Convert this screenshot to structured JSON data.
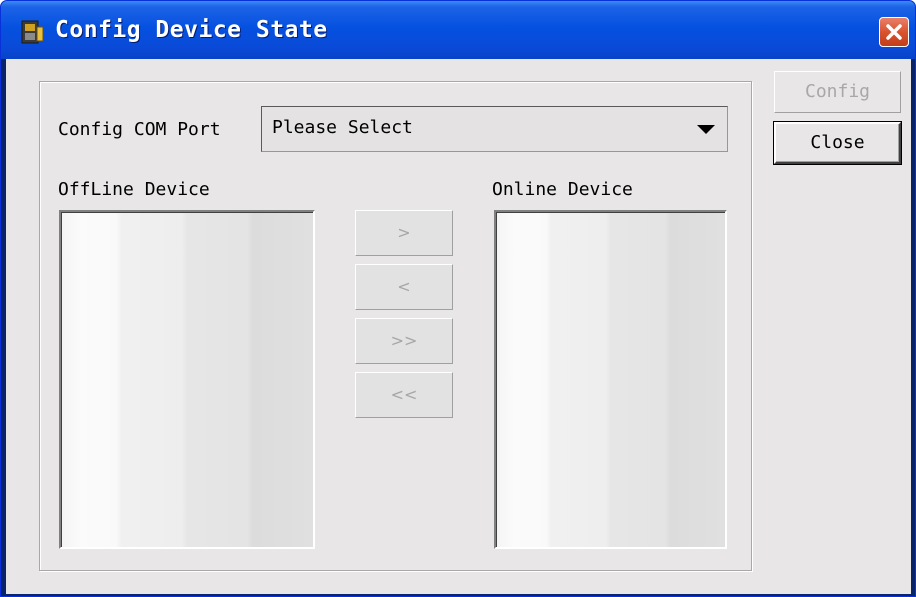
{
  "window": {
    "title": "Config Device State",
    "icon": "application-icon",
    "close_icon": "close-icon"
  },
  "com_port": {
    "label": "Config COM Port",
    "selected": "Please Select"
  },
  "offline": {
    "label": "OffLine Device",
    "items": []
  },
  "online": {
    "label": "Online Device",
    "items": []
  },
  "transfer_buttons": {
    "move_right": ">",
    "move_left": "<",
    "move_all_right": ">>",
    "move_all_left": "<<"
  },
  "actions": {
    "config": "Config",
    "close": "Close"
  },
  "colors": {
    "titlebar": "#0551e0",
    "close_button": "#d9532f",
    "client_bg": "#e8e6e7",
    "disabled_text": "#a8a8a8"
  }
}
